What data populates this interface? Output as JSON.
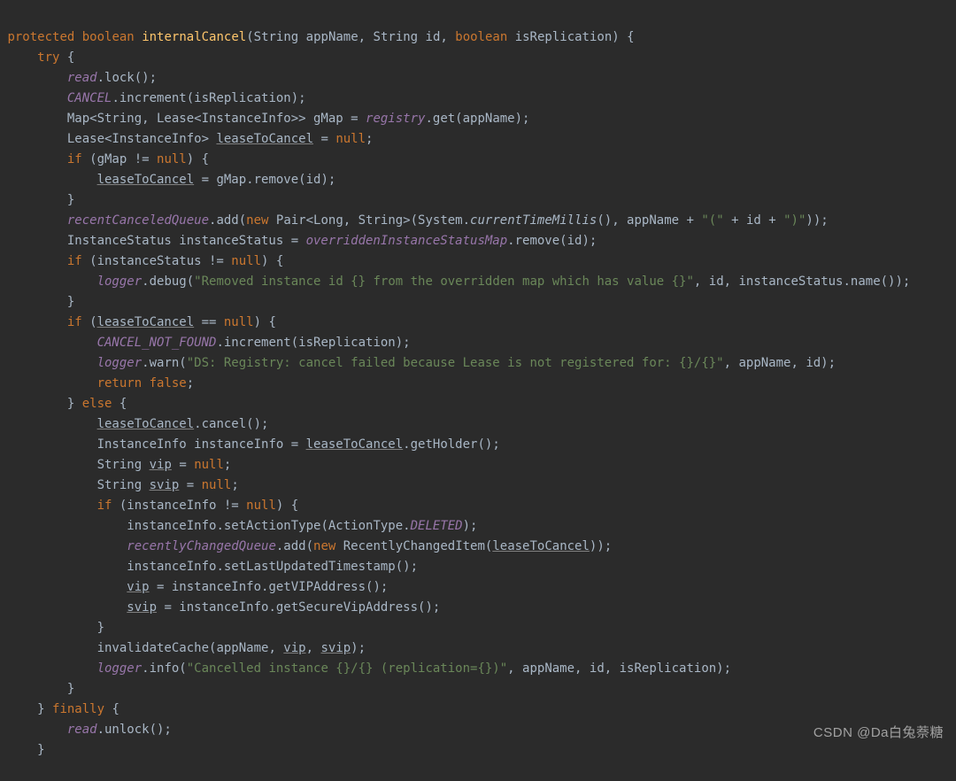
{
  "watermark": "CSDN @Da白兔萘糖",
  "code": {
    "l01": {
      "protected": "protected",
      "boolean": "boolean",
      "fn": "internalCancel",
      "lp": "(",
      "String1": "String ",
      "appName": "appName",
      "c1": ", ",
      "String2": "String ",
      "id": "id",
      "c2": ", ",
      "boolean2": "boolean ",
      "isRepl": "isReplication",
      "rp": ") {"
    },
    "l02": {
      "try": "try",
      "brace": " {"
    },
    "l03": {
      "read": "read",
      "dot": ".",
      "lock": "lock();"
    },
    "l04": {
      "CANCEL": "CANCEL",
      "dot": ".",
      "incr": "increment(isReplication);"
    },
    "l05": {
      "Map": "Map<String, Lease<InstanceInfo>> gMap = ",
      "reg": "registry",
      "dot": ".",
      "get": "get(appName);"
    },
    "l06": {
      "Lease": "Lease<InstanceInfo> ",
      "ltc": "leaseToCancel",
      "eq": " = ",
      "null": "null",
      ";": ";"
    },
    "l07": {
      "if": "if",
      "cond": " (gMap != ",
      "null": "null",
      "rp": ") {"
    },
    "l08": {
      "ltc": "leaseToCancel",
      "eq": " = gMap.remove(id);"
    },
    "l09": {
      "brace": "}"
    },
    "l10": {
      "rcq": "recentCanceledQueue",
      "dot": ".add(",
      "new": "new",
      "pair": " Pair<Long, String>(System.",
      "ctm": "currentTimeMillis",
      "rest": "(), appName + ",
      "s1": "\"(\"",
      "p2": " + id + ",
      "s2": "\")\"",
      "end": "));"
    },
    "l11": {
      "txt": "InstanceStatus instanceStatus = ",
      "map": "overriddenInstanceStatusMap",
      "rest": ".remove(id);"
    },
    "l12": {
      "if": "if",
      "cond": " (instanceStatus != ",
      "null": "null",
      "rp": ") {"
    },
    "l13": {
      "logger": "logger",
      "dot": ".debug(",
      "s": "\"Removed instance id {} from the overridden map which has value {}\"",
      "rest": ", id, instanceStatus.name());"
    },
    "l14": {
      "brace": "}"
    },
    "l15": {
      "if": "if",
      "lp": " (",
      "ltc": "leaseToCancel",
      "cond": " == ",
      "null": "null",
      "rp": ") {"
    },
    "l16": {
      "CNF": "CANCEL_NOT_FOUND",
      "rest": ".increment(isReplication);"
    },
    "l17": {
      "logger": "logger",
      "dot": ".warn(",
      "s": "\"DS: Registry: cancel failed because Lease is not registered for: {}/{}\"",
      "rest": ", appName, id);"
    },
    "l18": {
      "return": "return",
      "sp": " ",
      "false": "false",
      ";": ";"
    },
    "l19": {
      "brace": "} ",
      "else": "else",
      "b2": " {"
    },
    "l20": {
      "ltc": "leaseToCancel",
      "rest": ".cancel();"
    },
    "l21": {
      "txt": "InstanceInfo instanceInfo = ",
      "ltc": "leaseToCancel",
      "rest": ".getHolder();"
    },
    "l22": {
      "txt": "String ",
      "vip": "vip",
      "eq": " = ",
      "null": "null",
      ";": ";"
    },
    "l23": {
      "txt": "String ",
      "svip": "svip",
      "eq": " = ",
      "null": "null",
      ";": ";"
    },
    "l24": {
      "if": "if",
      "cond": " (instanceInfo != ",
      "null": "null",
      "rp": ") {"
    },
    "l25": {
      "txt": "instanceInfo.setActionType(ActionType.",
      "DEL": "DELETED",
      "rest": ");"
    },
    "l26": {
      "rcq": "recentlyChangedQueue",
      "dot": ".add(",
      "new": "new",
      "txt": " RecentlyChangedItem(",
      "ltc": "leaseToCancel",
      "rest": "));"
    },
    "l27": {
      "txt": "instanceInfo.setLastUpdatedTimestamp();"
    },
    "l28": {
      "vip": "vip",
      "rest": " = instanceInfo.getVIPAddress();"
    },
    "l29": {
      "svip": "svip",
      "rest": " = instanceInfo.getSecureVipAddress();"
    },
    "l30": {
      "brace": "}"
    },
    "l31": {
      "txt": "invalidateCache(appName, ",
      "vip": "vip",
      "c": ", ",
      "svip": "svip",
      "rest": ");"
    },
    "l32": {
      "logger": "logger",
      "dot": ".info(",
      "s": "\"Cancelled instance {}/{} (replication={})\"",
      "rest": ", appName, id, isReplication);"
    },
    "l33": {
      "brace": "}"
    },
    "l34": {
      "brace": "} ",
      "finally": "finally",
      "b2": " {"
    },
    "l35": {
      "read": "read",
      "rest": ".unlock();"
    },
    "l36": {
      "brace": "}"
    }
  }
}
